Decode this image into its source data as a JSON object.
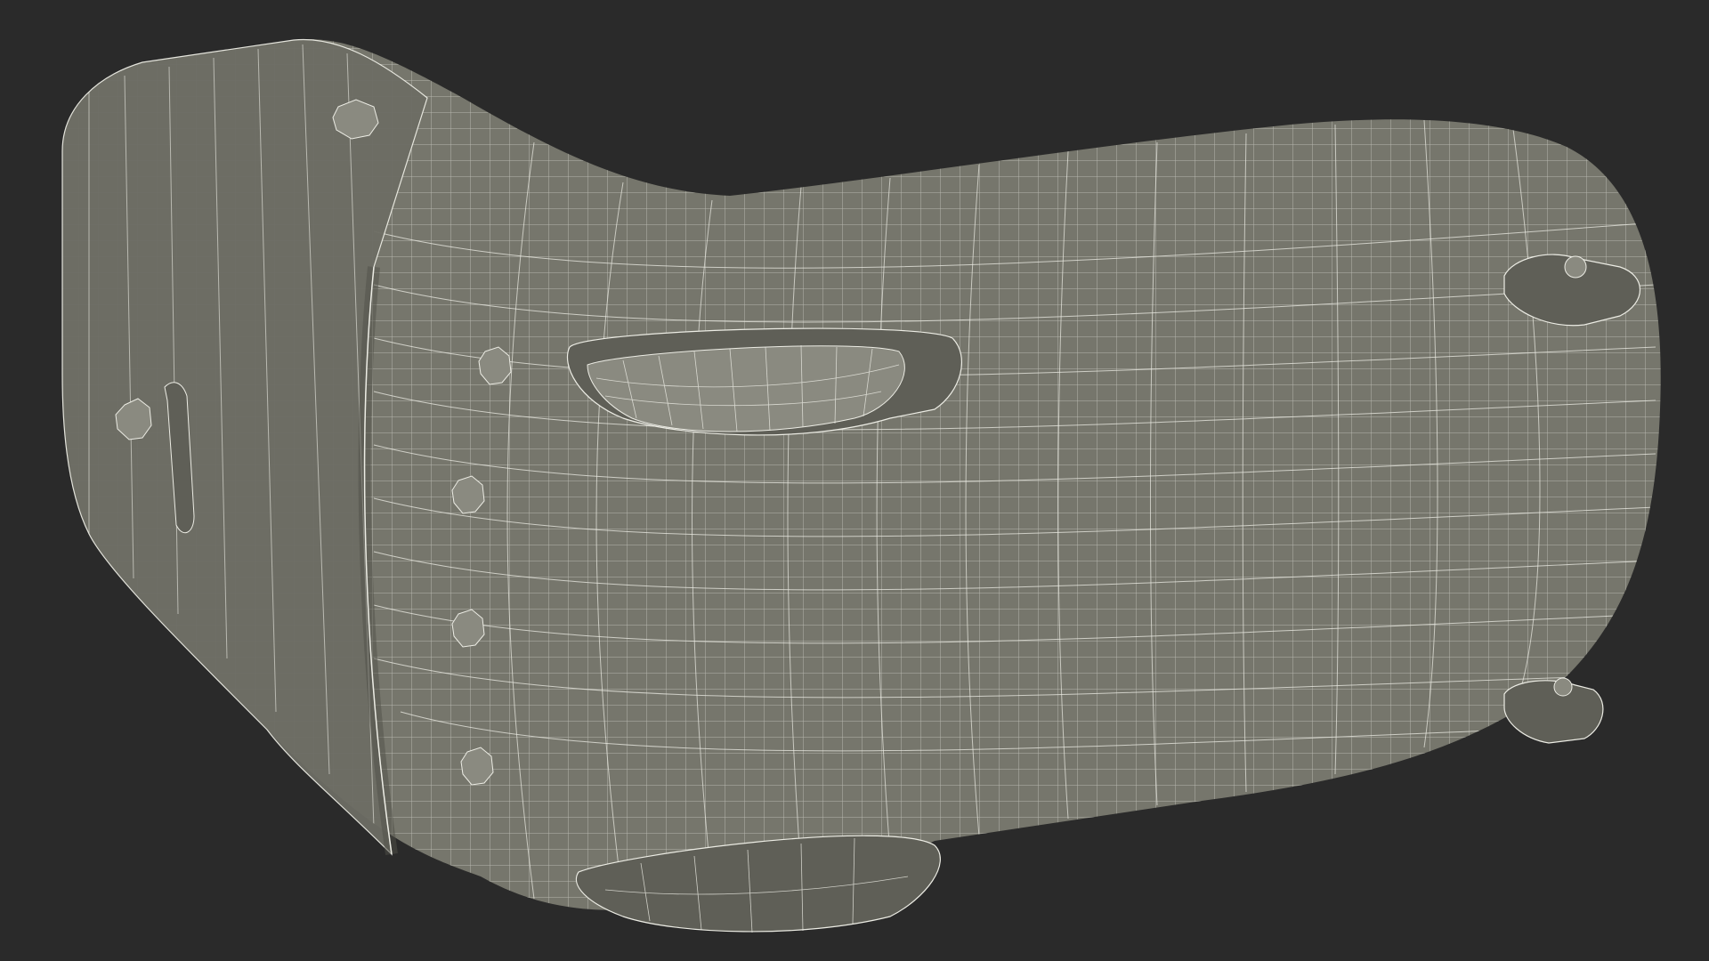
{
  "scene": {
    "background_color": "#2a2a2a",
    "model": {
      "subject": "wireframe-3d-model",
      "shade_color": "#76766c",
      "shade_dark_color": "#5f5f57",
      "shade_light_color": "#8a8a80",
      "wire_color": "#ecece4",
      "features": [
        "main-body",
        "end-cap",
        "top-handle",
        "bottom-handle",
        "mount-clip-top",
        "mount-clip-bottom",
        "bolt-heads"
      ]
    }
  }
}
